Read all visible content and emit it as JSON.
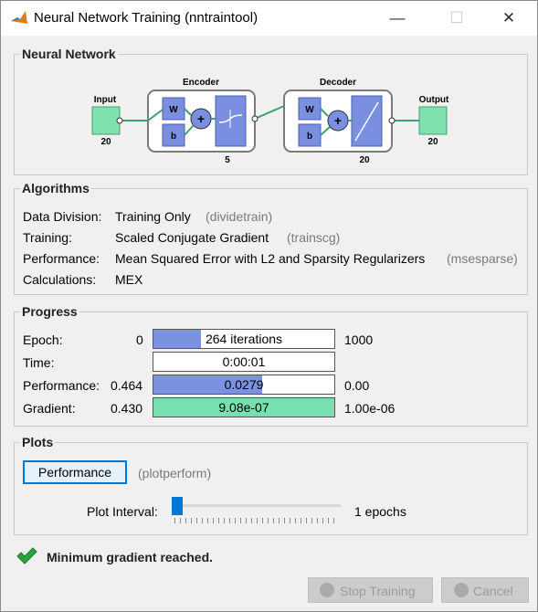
{
  "window": {
    "title": "Neural Network Training (nntraintool)"
  },
  "network": {
    "section_title": "Neural Network",
    "input_label": "Input",
    "input_size": "20",
    "encoder_label": "Encoder",
    "encoder_size": "5",
    "decoder_label": "Decoder",
    "decoder_size": "20",
    "output_label": "Output",
    "output_size": "20",
    "weight_label": "W",
    "bias_label": "b"
  },
  "algorithms": {
    "section_title": "Algorithms",
    "rows": [
      {
        "label": "Data Division:",
        "value": "Training Only",
        "code": "(dividetrain)"
      },
      {
        "label": "Training:",
        "value": "Scaled Conjugate Gradient",
        "code": "(trainscg)"
      },
      {
        "label": "Performance:",
        "value": "Mean Squared Error with L2 and Sparsity Regularizers",
        "code": "(msesparse)"
      },
      {
        "label": "Calculations:",
        "value": "MEX",
        "code": ""
      }
    ]
  },
  "progress": {
    "section_title": "Progress",
    "rows": [
      {
        "label": "Epoch:",
        "min": "0",
        "value": "264 iterations",
        "max": "1000",
        "fraction": 0.264
      },
      {
        "label": "Time:",
        "min": "",
        "value": "0:00:01",
        "max": "",
        "fraction": 0
      },
      {
        "label": "Performance:",
        "min": "0.464",
        "value": "0.0279",
        "max": "0.00",
        "fraction": 0.6
      },
      {
        "label": "Gradient:",
        "min": "0.430",
        "value": "9.08e-07",
        "max": "1.00e-06",
        "fraction": 1.0
      }
    ]
  },
  "plots": {
    "section_title": "Plots",
    "performance_button": "Performance",
    "performance_code": "(plotperform)",
    "interval_label": "Plot Interval:",
    "interval_value": "1 epochs",
    "interval_fraction": 0.0
  },
  "status": {
    "text": "Minimum gradient reached."
  },
  "buttons": {
    "stop": "Stop Training",
    "cancel": "Cancel"
  },
  "colors": {
    "accent": "#0078d7",
    "progress_blue": "#7a92e0",
    "progress_green": "#77e0b0",
    "node_green": "#7fe0b0",
    "block_blue": "#7a8fe0",
    "status_green": "#2aa33a"
  }
}
